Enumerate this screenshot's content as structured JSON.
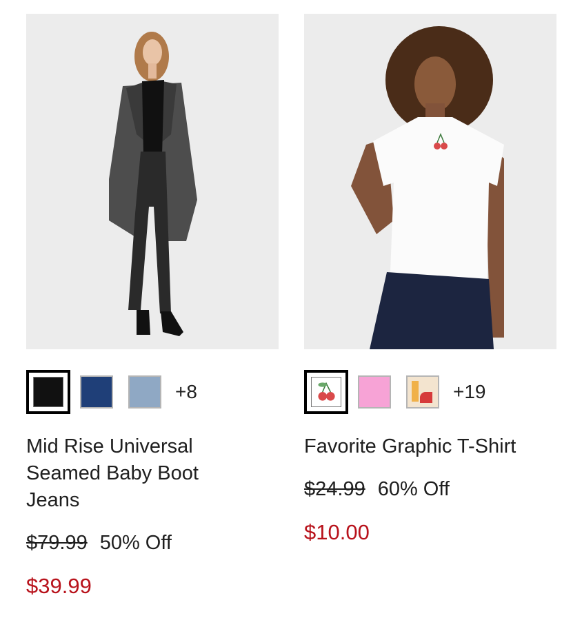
{
  "products": [
    {
      "name": "Mid Rise Universal Seamed Baby Boot Jeans",
      "more_colors": "+8",
      "original_price": "$79.99",
      "discount": "50% Off",
      "sale_price": "$39.99",
      "swatch_colors": [
        "#111111",
        "#1f3f78",
        "#8fa8c4"
      ]
    },
    {
      "name": "Favorite Graphic T-Shirt",
      "more_colors": "+19",
      "original_price": "$24.99",
      "discount": "60% Off",
      "sale_price": "$10.00",
      "swatch_colors": [
        "#ffffff",
        "#f7a3d6",
        "#f3e4cf"
      ]
    }
  ],
  "colors": {
    "sale": "#b8121b",
    "text": "#1f1f1f",
    "photo_bg": "#ececec"
  }
}
